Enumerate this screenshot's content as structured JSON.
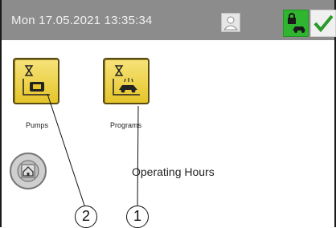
{
  "status_bar": {
    "datetime": "Mon 17.05.2021  13:35:34",
    "colors": {
      "background": "#8c8c8c",
      "lock_active": "#2fb52f",
      "ok_check": "#2a9a2a"
    }
  },
  "tiles": [
    {
      "label": "Pumps",
      "icon": "hourglass-pump-icon"
    },
    {
      "label": "Programs",
      "icon": "hourglass-car-wash-icon"
    }
  ],
  "main": {
    "heading": "Operating Hours"
  },
  "callouts": [
    "2",
    "1"
  ],
  "icons": {
    "user": "user-icon",
    "lock": "lock-car-icon",
    "ok": "checkmark-icon",
    "home": "home-icon"
  }
}
